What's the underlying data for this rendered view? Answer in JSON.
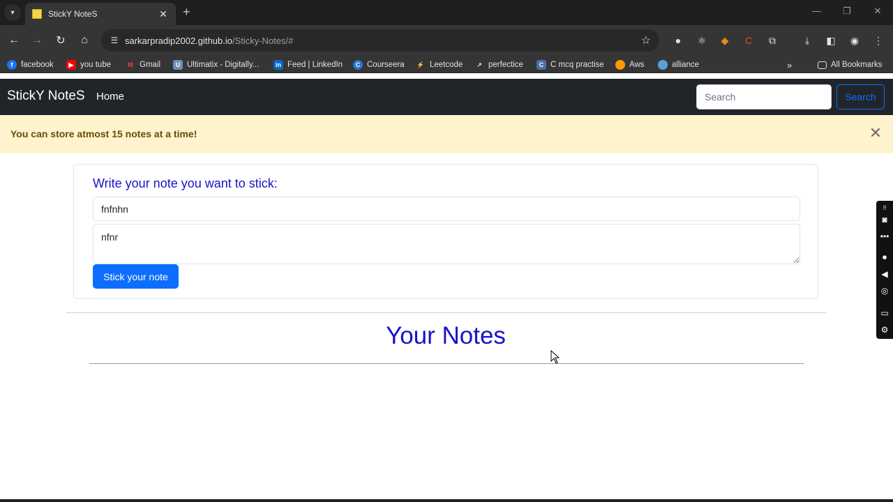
{
  "browser": {
    "tab_title": "StickY NoteS",
    "url_host": "sarkarpradip2002.github.io",
    "url_path": "/Sticky-Notes/#",
    "bookmarks": [
      {
        "label": "facebook",
        "color": "#1877f2",
        "icon": "facebook-icon"
      },
      {
        "label": "you tube",
        "color": "#ff0000",
        "icon": "youtube-icon"
      },
      {
        "label": "Gmail",
        "color": "#ea4335",
        "icon": "gmail-icon"
      },
      {
        "label": "Ultimatix - Digitally...",
        "color": "#3b5998",
        "icon": "ultimatix-icon"
      },
      {
        "label": "Feed | LinkedIn",
        "color": "#0a66c2",
        "icon": "linkedin-icon"
      },
      {
        "label": "Courseera",
        "color": "#2a73cc",
        "icon": "coursera-icon"
      },
      {
        "label": "Leetcode",
        "color": "#ffa116",
        "icon": "leetcode-icon"
      },
      {
        "label": "perfectice",
        "color": "#5f6368",
        "icon": "external-link-icon"
      },
      {
        "label": "C mcq practise",
        "color": "#4a6fa5",
        "icon": "cmcq-icon"
      },
      {
        "label": "Aws",
        "color": "#ff9900",
        "icon": "aws-icon"
      },
      {
        "label": "alliance",
        "color": "#5aa0d8",
        "icon": "alliance-icon"
      }
    ],
    "all_bookmarks": "All Bookmarks"
  },
  "navbar": {
    "brand": "StickY NoteS",
    "home": "Home",
    "search_placeholder": "Search",
    "search_button": "Search"
  },
  "alert": {
    "message": "You can store atmost 15 notes at a time!"
  },
  "form": {
    "heading": "Write your note you want to stick:",
    "title_value": "fnfnhn",
    "text_value": "nfnr",
    "submit": "Stick your note"
  },
  "notes": {
    "heading": "Your Notes"
  }
}
